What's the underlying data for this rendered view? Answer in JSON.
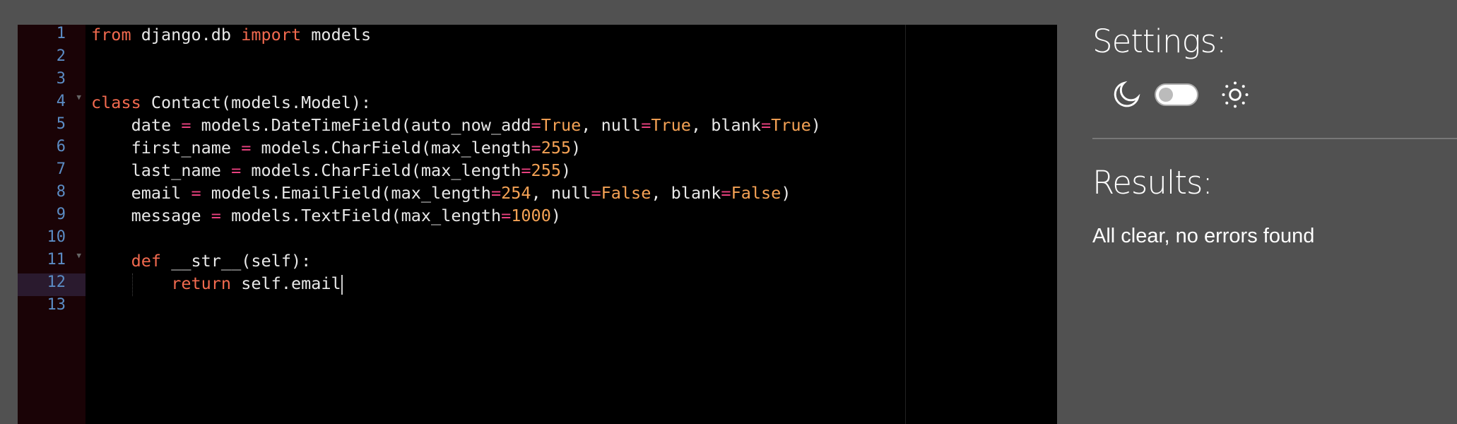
{
  "editor": {
    "active_line": 12,
    "fold_lines": [
      4,
      11
    ],
    "lines": [
      [
        [
          "kw",
          "from"
        ],
        [
          "t",
          " django.db "
        ],
        [
          "kw",
          "import"
        ],
        [
          "t",
          " models"
        ]
      ],
      [],
      [],
      [
        [
          "kw",
          "class"
        ],
        [
          "t",
          " Contact(models.Model):"
        ]
      ],
      [
        [
          "t",
          "    date "
        ],
        [
          "op",
          "="
        ],
        [
          "t",
          " models.DateTimeField(auto_now_add"
        ],
        [
          "op",
          "="
        ],
        [
          "num-t",
          "True"
        ],
        [
          "t",
          ", null"
        ],
        [
          "op",
          "="
        ],
        [
          "num-t",
          "True"
        ],
        [
          "t",
          ", blank"
        ],
        [
          "op",
          "="
        ],
        [
          "num-t",
          "True"
        ],
        [
          "t",
          ")"
        ]
      ],
      [
        [
          "t",
          "    first_name "
        ],
        [
          "op",
          "="
        ],
        [
          "t",
          " models.CharField(max_length"
        ],
        [
          "op",
          "="
        ],
        [
          "num-t",
          "255"
        ],
        [
          "t",
          ")"
        ]
      ],
      [
        [
          "t",
          "    last_name "
        ],
        [
          "op",
          "="
        ],
        [
          "t",
          " models.CharField(max_length"
        ],
        [
          "op",
          "="
        ],
        [
          "num-t",
          "255"
        ],
        [
          "t",
          ")"
        ]
      ],
      [
        [
          "t",
          "    email "
        ],
        [
          "op",
          "="
        ],
        [
          "t",
          " models.EmailField(max_length"
        ],
        [
          "op",
          "="
        ],
        [
          "num-t",
          "254"
        ],
        [
          "t",
          ", null"
        ],
        [
          "op",
          "="
        ],
        [
          "num-t",
          "False"
        ],
        [
          "t",
          ", blank"
        ],
        [
          "op",
          "="
        ],
        [
          "num-t",
          "False"
        ],
        [
          "t",
          ")"
        ]
      ],
      [
        [
          "t",
          "    message "
        ],
        [
          "op",
          "="
        ],
        [
          "t",
          " models.TextField(max_length"
        ],
        [
          "op",
          "="
        ],
        [
          "num-t",
          "1000"
        ],
        [
          "t",
          ")"
        ]
      ],
      [],
      [
        [
          "t",
          "    "
        ],
        [
          "kw",
          "def"
        ],
        [
          "t",
          " __str__(self):"
        ]
      ],
      [
        [
          "t",
          "        "
        ],
        [
          "kw",
          "return"
        ],
        [
          "t",
          " self.email"
        ]
      ],
      []
    ]
  },
  "settings": {
    "title": "Settings:",
    "theme_toggle_on": false,
    "dark_icon": "moon-icon",
    "light_icon": "sun-icon"
  },
  "results": {
    "title": "Results:",
    "message": "All clear, no errors found"
  },
  "colors": {
    "keyword": "#f26a4f",
    "operator": "#e9417f",
    "literal": "#f5a255",
    "line_number": "#5b8cc4",
    "background": "#515151"
  }
}
